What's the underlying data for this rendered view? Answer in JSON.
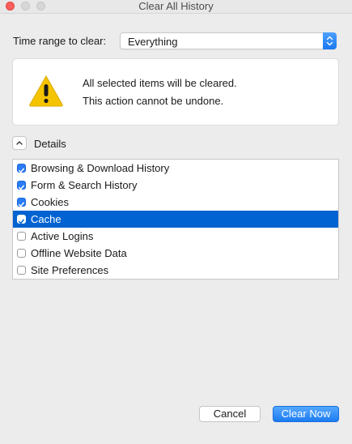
{
  "window": {
    "title": "Clear All History"
  },
  "time_range": {
    "label": "Time range to clear:",
    "selected": "Everything"
  },
  "notice": {
    "line1": "All selected items will be cleared.",
    "line2": "This action cannot be undone.",
    "icon": "warning-icon"
  },
  "details": {
    "label": "Details",
    "expanded": true,
    "items": [
      {
        "label": "Browsing & Download History",
        "checked": true,
        "selected": false
      },
      {
        "label": "Form & Search History",
        "checked": true,
        "selected": false
      },
      {
        "label": "Cookies",
        "checked": true,
        "selected": false
      },
      {
        "label": "Cache",
        "checked": true,
        "selected": true
      },
      {
        "label": "Active Logins",
        "checked": false,
        "selected": false
      },
      {
        "label": "Offline Website Data",
        "checked": false,
        "selected": false
      },
      {
        "label": "Site Preferences",
        "checked": false,
        "selected": false
      }
    ]
  },
  "buttons": {
    "cancel": "Cancel",
    "clear_now": "Clear Now"
  },
  "colors": {
    "accent": "#1c7cf0",
    "selection": "#0063d1",
    "warning": "#f5c400"
  }
}
